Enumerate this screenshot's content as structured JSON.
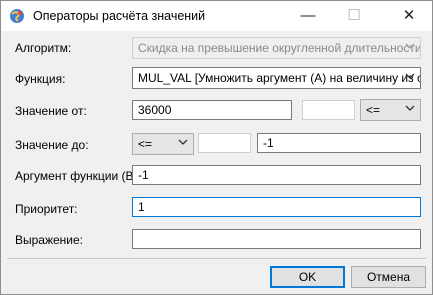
{
  "window": {
    "title": "Операторы расчёта значений",
    "app_icon": "globe-app-icon",
    "controls": {
      "minimize": "—",
      "maximize": "☐",
      "close": "✕"
    }
  },
  "form": {
    "algorithm": {
      "label": "Алгоритм:",
      "value": "Скидка на превышение округленной длительности"
    },
    "function": {
      "label": "Функция:",
      "value": "MUL_VAL [Умножить аргумент (А) на величину из ста"
    },
    "value_from": {
      "label": "Значение от:",
      "value": "36000",
      "extra_value": "",
      "operator": "<="
    },
    "value_to": {
      "label": "Значение до:",
      "operator": "<=",
      "extra_value": "",
      "value": "-1"
    },
    "argument_b": {
      "label": "Аргумент функции (В):",
      "value": "-1"
    },
    "priority": {
      "label": "Приоритет:",
      "value": "1"
    },
    "expression": {
      "label": "Выражение:",
      "value": ""
    }
  },
  "buttons": {
    "ok": "OK",
    "cancel": "Отмена"
  },
  "colors": {
    "focus_border": "#0078d7",
    "window_bg": "#f0f0f0"
  }
}
